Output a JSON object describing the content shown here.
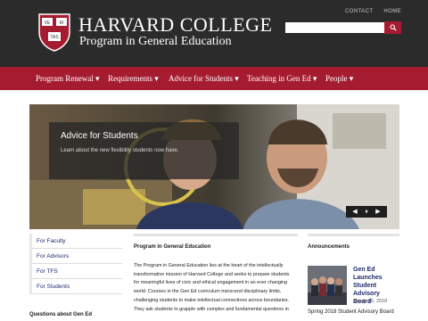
{
  "header": {
    "title": "HARVARD COLLEGE",
    "subtitle": "Program in General Education",
    "shield_text": [
      "VE",
      "RI",
      "TAS"
    ],
    "top_links": [
      "CONTACT",
      "HOME"
    ],
    "search": {
      "placeholder": "",
      "button_icon": "search-icon"
    }
  },
  "nav": {
    "items": [
      {
        "label": "Program Renewal ▾"
      },
      {
        "label": "Requirements ▾"
      },
      {
        "label": "Advice for Students ▾"
      },
      {
        "label": "Teaching in Gen Ed ▾"
      },
      {
        "label": "People ▾"
      }
    ]
  },
  "hero": {
    "title": "Advice for Students",
    "text": "Learn about the new flexibility students now have.",
    "pager": {
      "prev": "◀",
      "pause": "⏸",
      "next": "▶"
    }
  },
  "sidebar": {
    "items": [
      {
        "label": "For Faculty"
      },
      {
        "label": "For Advisors"
      },
      {
        "label": "For TFS"
      },
      {
        "label": "For Students"
      }
    ],
    "heading": "Questions about Gen Ed"
  },
  "main": {
    "heading": "Program in General Education",
    "body_lines": [
      "The Program in General Education lies at the heart of the intellectually",
      "transformative mission of Harvard College and seeks to prepare students",
      "for meaningful lives of civic and ethical engagement in an ever changing",
      "world. Courses in the Gen Ed curriculum transcend disciplinary limits,",
      "challenging students to make intellectual connections across boundaries.",
      "They ask students to grapple with complex and fundamental questions in"
    ]
  },
  "announcements": {
    "heading": "Announcements",
    "item_title": "Gen Ed Launches Student Advisory Board",
    "item_date": "March 16, 2018",
    "item_subtitle": "Spring 2018 Student Advisory Board"
  },
  "colors": {
    "header_bg": "#2b2b2b",
    "accent_crimson": "#a51c30",
    "link_blue": "#1e2b6e"
  }
}
